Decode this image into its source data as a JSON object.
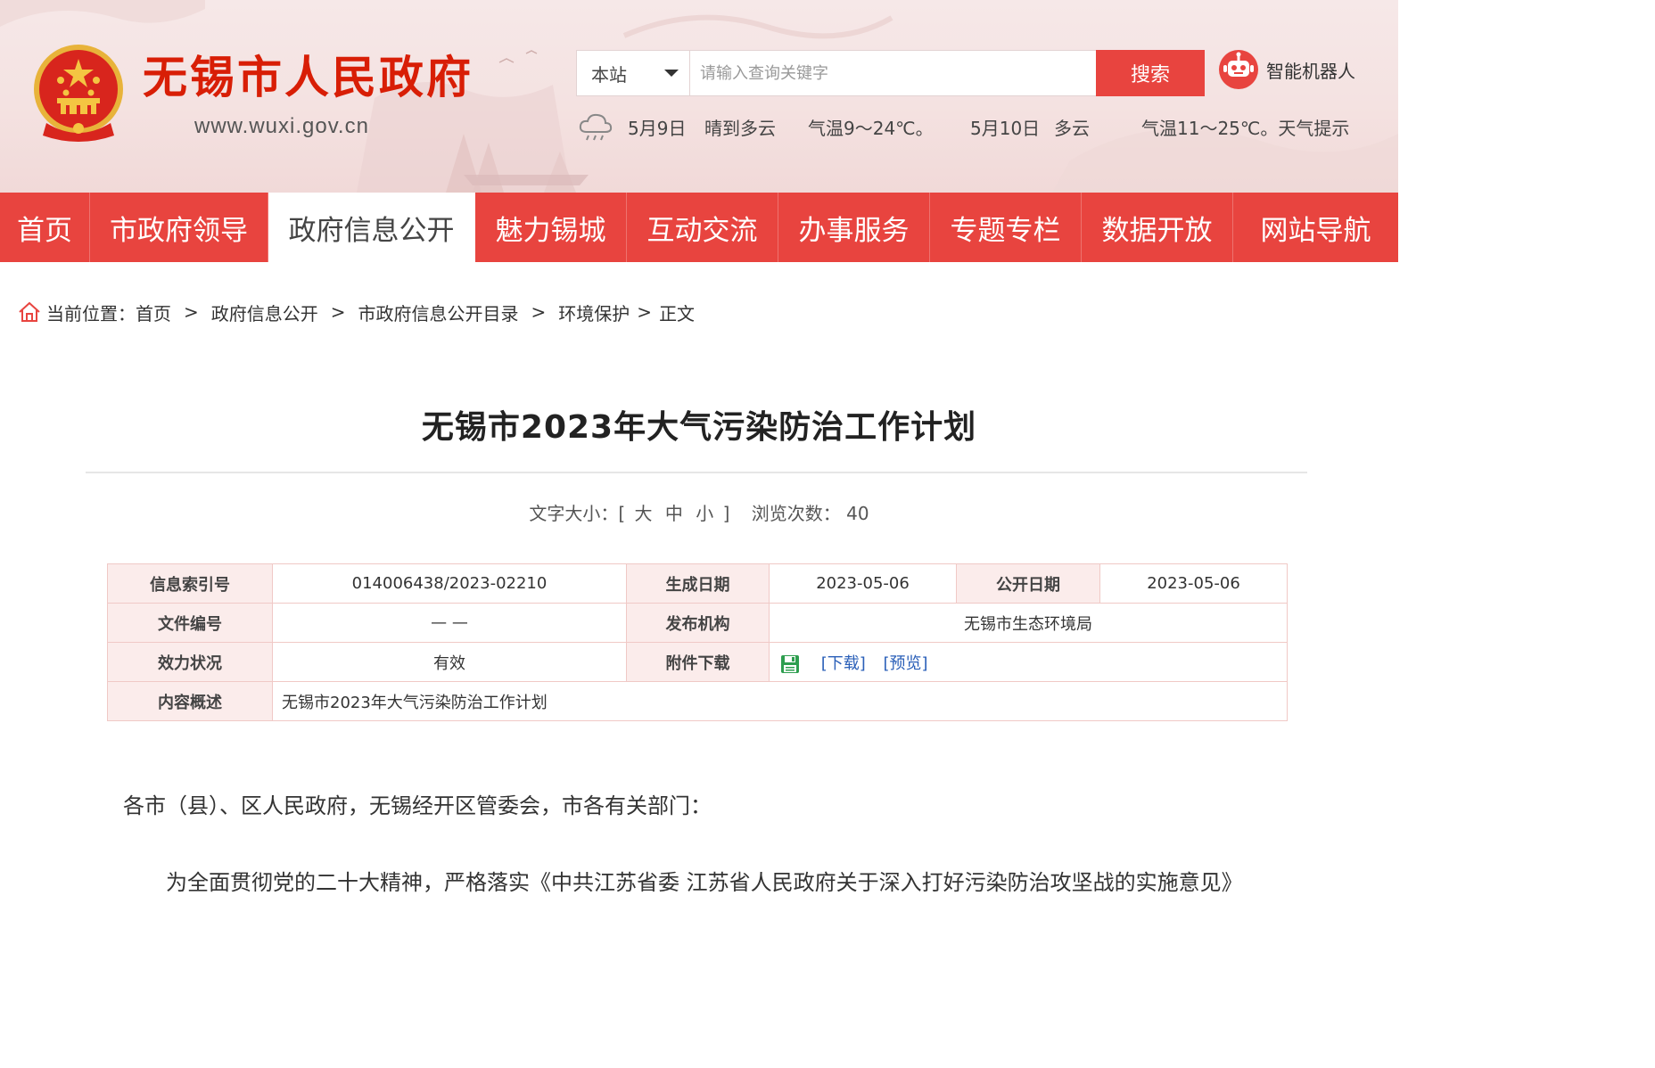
{
  "header": {
    "site_name": "无锡市人民政府",
    "site_url": "www.wuxi.gov.cn",
    "search": {
      "scope": "本站",
      "placeholder": "请输入查询关键字",
      "button": "搜索"
    },
    "robot_label": "智能机器人",
    "weather": {
      "day1_date": "5月9日",
      "day1_desc": "晴到多云",
      "day1_temp": "气温9～24℃。",
      "day2_date": "5月10日",
      "day2_desc": "多云",
      "day2_temp": "气温11～25℃。天气提示"
    }
  },
  "nav": {
    "items": [
      "首页",
      "市政府领导",
      "政府信息公开",
      "魅力锡城",
      "互动交流",
      "办事服务",
      "专题专栏",
      "数据开放",
      "网站导航"
    ],
    "active": "政府信息公开"
  },
  "breadcrumb": {
    "prefix": "当前位置：",
    "items": [
      "首页",
      "政府信息公开",
      "市政府信息公开目录",
      "环境保护",
      "正文"
    ],
    "separator": ">"
  },
  "article": {
    "title": "无锡市2023年大气污染防治工作计划",
    "font_size_label": "文字大小：[",
    "font_sizes": [
      "大",
      "中",
      "小"
    ],
    "font_size_close": "]",
    "views_label": "浏览次数：",
    "views": "40"
  },
  "info": {
    "index_label": "信息索引号",
    "index_value": "014006438/2023-02210",
    "created_label": "生成日期",
    "created_value": "2023-05-06",
    "published_label": "公开日期",
    "published_value": "2023-05-06",
    "doc_no_label": "文件编号",
    "doc_no_value": "— —",
    "issuer_label": "发布机构",
    "issuer_value": "无锡市生态环境局",
    "status_label": "效力状况",
    "status_value": "有效",
    "attach_label": "附件下载",
    "download_link": "[下载]",
    "preview_link": "[预览]",
    "summary_label": "内容概述",
    "summary_value": "无锡市2023年大气污染防治工作计划"
  },
  "body": {
    "salutation": "各市（县）、区人民政府，无锡经开区管委会，市各有关部门：",
    "para1": "为全面贯彻党的二十大精神，严格落实《中共江苏省委 江苏省人民政府关于深入打好污染防治攻坚战的实施意见》"
  },
  "colors": {
    "brand_red": "#e8443f",
    "title_red": "#d81e06",
    "link_blue": "#2a5fb8",
    "table_label_bg": "#fbeceb"
  }
}
